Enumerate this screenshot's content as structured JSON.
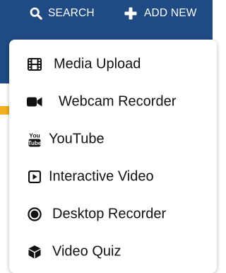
{
  "header": {
    "search_label": "SEARCH",
    "add_new_label": "ADD NEW",
    "bg_color": "#1f4a84",
    "text_color": "#ffffff"
  },
  "menu": {
    "items": [
      {
        "label": "Media Upload",
        "icon": "film-icon"
      },
      {
        "label": "Webcam Recorder",
        "icon": "video-camera-icon"
      },
      {
        "label": "YouTube",
        "icon": "youtube-icon"
      },
      {
        "label": "Interactive Video",
        "icon": "play-square-icon"
      },
      {
        "label": "Desktop Recorder",
        "icon": "record-circle-icon"
      },
      {
        "label": "Video Quiz",
        "icon": "cube-icon"
      }
    ]
  }
}
